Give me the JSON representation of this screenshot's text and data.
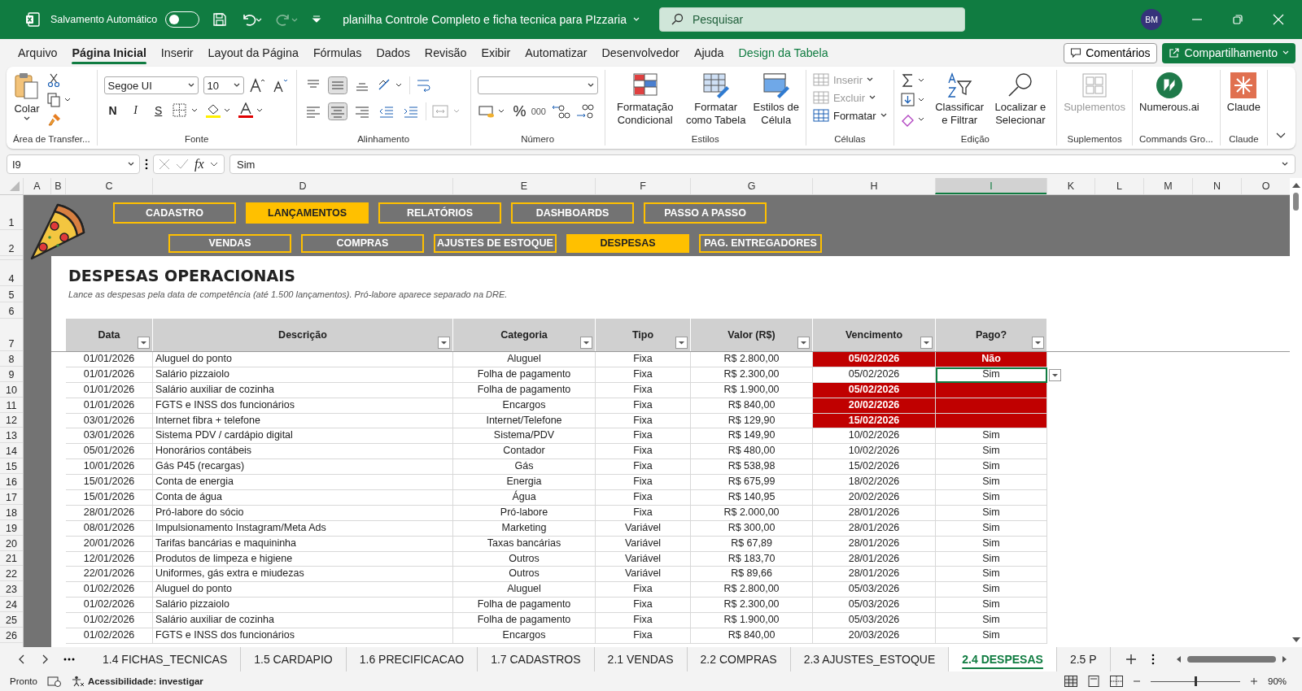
{
  "title_bar": {
    "autosave_label": "Salvamento Automático",
    "autosave_on": false,
    "document_title": "planilha Controle Completo e ficha tecnica para PIzzaria",
    "search_placeholder": "Pesquisar",
    "avatar": "BM"
  },
  "menu": [
    {
      "label": "Arquivo",
      "selected": false,
      "contextual": false
    },
    {
      "label": "Página Inicial",
      "selected": true,
      "contextual": false
    },
    {
      "label": "Inserir",
      "selected": false,
      "contextual": false
    },
    {
      "label": "Layout da Página",
      "selected": false,
      "contextual": false
    },
    {
      "label": "Fórmulas",
      "selected": false,
      "contextual": false
    },
    {
      "label": "Dados",
      "selected": false,
      "contextual": false
    },
    {
      "label": "Revisão",
      "selected": false,
      "contextual": false
    },
    {
      "label": "Exibir",
      "selected": false,
      "contextual": false
    },
    {
      "label": "Automatizar",
      "selected": false,
      "contextual": false
    },
    {
      "label": "Desenvolvedor",
      "selected": false,
      "contextual": false
    },
    {
      "label": "Ajuda",
      "selected": false,
      "contextual": false
    },
    {
      "label": "Design da Tabela",
      "selected": false,
      "contextual": true
    }
  ],
  "comments_button": "Comentários",
  "share_button": "Compartilhamento",
  "ribbon": [
    {
      "kind": "clipboard",
      "label": "Área de Transfer...",
      "paste": "Colar"
    },
    {
      "kind": "font",
      "label": "Fonte",
      "font": "Segoe UI",
      "size": "10",
      "bold": "N",
      "italic": "I",
      "underline": "S"
    },
    {
      "kind": "alignment",
      "label": "Alinhamento"
    },
    {
      "kind": "number",
      "label": "Número",
      "percent": "%",
      "thousands": "000"
    },
    {
      "kind": "large",
      "label": "Estilos",
      "buttons": [
        {
          "kind": "conditional",
          "label": "Formatação Condicional",
          "disabled": false
        },
        {
          "kind": "table",
          "label": "Formatar como Tabela",
          "disabled": false
        },
        {
          "kind": "styles",
          "label": "Estilos de Célula",
          "disabled": false
        }
      ]
    },
    {
      "kind": "cells",
      "label": "Células",
      "buttons": [
        {
          "label": "Inserir",
          "disabled": true
        },
        {
          "label": "Excluir",
          "disabled": true
        },
        {
          "label": "Formatar",
          "disabled": false
        }
      ]
    },
    {
      "kind": "editing",
      "label": "Edição",
      "buttons": [
        {
          "kind": "sort",
          "label": "Classificar e Filtrar",
          "disabled": false
        },
        {
          "kind": "find",
          "label": "Localizar e Selecionar",
          "disabled": false
        }
      ]
    },
    {
      "kind": "large",
      "label": "Suplementos",
      "buttons": [
        {
          "kind": "addins",
          "label": "Suplementos",
          "disabled": true
        }
      ]
    },
    {
      "kind": "large",
      "label": "Commands Gro...",
      "buttons": [
        {
          "kind": "numerous",
          "label": "Numerous.ai",
          "disabled": false
        }
      ]
    },
    {
      "kind": "large",
      "label": "Claude",
      "buttons": [
        {
          "kind": "claude",
          "label": "Claude",
          "disabled": false
        }
      ]
    }
  ],
  "formula_bar": {
    "name_box": "I9",
    "function_label": "fx",
    "formula": "Sim"
  },
  "column_headers": [
    {
      "label": "A",
      "selected": false
    },
    {
      "label": "B",
      "selected": false
    },
    {
      "label": "C",
      "selected": false
    },
    {
      "label": "D",
      "selected": false
    },
    {
      "label": "E",
      "selected": false
    },
    {
      "label": "F",
      "selected": false
    },
    {
      "label": "G",
      "selected": false
    },
    {
      "label": "H",
      "selected": false
    },
    {
      "label": "I",
      "selected": true
    },
    {
      "label": "K",
      "selected": false
    },
    {
      "label": "L",
      "selected": false
    },
    {
      "label": "M",
      "selected": false
    },
    {
      "label": "N",
      "selected": false
    },
    {
      "label": "O",
      "selected": false
    }
  ],
  "top_row_numbers": [
    "1",
    "2",
    "4",
    "5",
    "6",
    "7"
  ],
  "nav_primary": [
    {
      "label": "CADASTRO",
      "selected": false
    },
    {
      "label": "LANÇAMENTOS",
      "selected": true
    },
    {
      "label": "RELATÓRIOS",
      "selected": false
    },
    {
      "label": "DASHBOARDS",
      "selected": false
    },
    {
      "label": "PASSO A PASSO",
      "selected": false
    }
  ],
  "nav_secondary": [
    {
      "label": "VENDAS",
      "selected": false
    },
    {
      "label": "COMPRAS",
      "selected": false
    },
    {
      "label": "AJUSTES DE ESTOQUE",
      "selected": false
    },
    {
      "label": "DESPESAS",
      "selected": true
    },
    {
      "label": "PAG. ENTREGADORES",
      "selected": false
    }
  ],
  "heading": "DESPESAS OPERACIONAIS",
  "subtitle": "Lance as despesas pela data de competência (até 1.500 lançamentos). Pró-labore aparece separado na DRE.",
  "table": {
    "columns": [
      "Data",
      "Descrição",
      "Categoria",
      "Tipo",
      "Valor (R$)",
      "Vencimento",
      "Pago?"
    ],
    "rows": [
      {
        "row": "8",
        "date": "01/01/2026",
        "description": "Aluguel do ponto",
        "category": "Aluguel",
        "type": "Fixa",
        "value": "R$ 2.800,00",
        "due": "05/02/2026",
        "paid": "Não",
        "overdue": true,
        "selected": false
      },
      {
        "row": "9",
        "date": "01/01/2026",
        "description": "Salário pizzaiolo",
        "category": "Folha de pagamento",
        "type": "Fixa",
        "value": "R$ 2.300,00",
        "due": "05/02/2026",
        "paid": "Sim",
        "overdue": false,
        "selected": true
      },
      {
        "row": "10",
        "date": "01/01/2026",
        "description": "Salário auxiliar de cozinha",
        "category": "Folha de pagamento",
        "type": "Fixa",
        "value": "R$ 1.900,00",
        "due": "05/02/2026",
        "overdue": true,
        "selected": false
      },
      {
        "row": "11",
        "date": "01/01/2026",
        "description": "FGTS e INSS dos funcionários",
        "category": "Encargos",
        "type": "Fixa",
        "value": "R$ 840,00",
        "due": "20/02/2026",
        "overdue": true,
        "selected": false
      },
      {
        "row": "12",
        "date": "03/01/2026",
        "description": "Internet fibra + telefone",
        "category": "Internet/Telefone",
        "type": "Fixa",
        "value": "R$ 129,90",
        "due": "15/02/2026",
        "overdue": true,
        "selected": false
      },
      {
        "row": "13",
        "date": "03/01/2026",
        "description": "Sistema PDV / cardápio digital",
        "category": "Sistema/PDV",
        "type": "Fixa",
        "value": "R$ 149,90",
        "due": "10/02/2026",
        "paid": "Sim",
        "overdue": false,
        "selected": false
      },
      {
        "row": "14",
        "date": "05/01/2026",
        "description": "Honorários contábeis",
        "category": "Contador",
        "type": "Fixa",
        "value": "R$ 480,00",
        "due": "10/02/2026",
        "paid": "Sim",
        "overdue": false,
        "selected": false
      },
      {
        "row": "15",
        "date": "10/01/2026",
        "description": "Gás P45 (recargas)",
        "category": "Gás",
        "type": "Fixa",
        "value": "R$ 538,98",
        "due": "15/02/2026",
        "paid": "Sim",
        "overdue": false,
        "selected": false
      },
      {
        "row": "16",
        "date": "15/01/2026",
        "description": "Conta de energia",
        "category": "Energia",
        "type": "Fixa",
        "value": "R$ 675,99",
        "due": "18/02/2026",
        "paid": "Sim",
        "overdue": false,
        "selected": false
      },
      {
        "row": "17",
        "date": "15/01/2026",
        "description": "Conta de água",
        "category": "Água",
        "type": "Fixa",
        "value": "R$ 140,95",
        "due": "20/02/2026",
        "paid": "Sim",
        "overdue": false,
        "selected": false
      },
      {
        "row": "18",
        "date": "28/01/2026",
        "description": "Pró-labore do sócio",
        "category": "Pró-labore",
        "type": "Fixa",
        "value": "R$ 2.000,00",
        "due": "28/01/2026",
        "paid": "Sim",
        "overdue": false,
        "selected": false
      },
      {
        "row": "19",
        "date": "08/01/2026",
        "description": "Impulsionamento Instagram/Meta Ads",
        "category": "Marketing",
        "type": "Variável",
        "value": "R$ 300,00",
        "due": "28/01/2026",
        "paid": "Sim",
        "overdue": false,
        "selected": false
      },
      {
        "row": "20",
        "date": "20/01/2026",
        "description": "Tarifas bancárias e maquininha",
        "category": "Taxas bancárias",
        "type": "Variável",
        "value": "R$ 67,89",
        "due": "28/01/2026",
        "paid": "Sim",
        "overdue": false,
        "selected": false
      },
      {
        "row": "21",
        "date": "12/01/2026",
        "description": "Produtos de limpeza e higiene",
        "category": "Outros",
        "type": "Variável",
        "value": "R$ 183,70",
        "due": "28/01/2026",
        "paid": "Sim",
        "overdue": false,
        "selected": false
      },
      {
        "row": "22",
        "date": "22/01/2026",
        "description": "Uniformes, gás extra e miudezas",
        "category": "Outros",
        "type": "Variável",
        "value": "R$ 89,66",
        "due": "28/01/2026",
        "paid": "Sim",
        "overdue": false,
        "selected": false
      },
      {
        "row": "23",
        "date": "01/02/2026",
        "description": "Aluguel do ponto",
        "category": "Aluguel",
        "type": "Fixa",
        "value": "R$ 2.800,00",
        "due": "05/03/2026",
        "paid": "Sim",
        "overdue": false,
        "selected": false
      },
      {
        "row": "24",
        "date": "01/02/2026",
        "description": "Salário pizzaiolo",
        "category": "Folha de pagamento",
        "type": "Fixa",
        "value": "R$ 2.300,00",
        "due": "05/03/2026",
        "paid": "Sim",
        "overdue": false,
        "selected": false
      },
      {
        "row": "25",
        "date": "01/02/2026",
        "description": "Salário auxiliar de cozinha",
        "category": "Folha de pagamento",
        "type": "Fixa",
        "value": "R$ 1.900,00",
        "due": "05/03/2026",
        "paid": "Sim",
        "overdue": false,
        "selected": false
      },
      {
        "row": "26",
        "date": "01/02/2026",
        "description": "FGTS e INSS dos funcionários",
        "category": "Encargos",
        "type": "Fixa",
        "value": "R$ 840,00",
        "due": "20/03/2026",
        "paid": "Sim",
        "overdue": false,
        "selected": false
      }
    ]
  },
  "sheet_tabs": [
    {
      "label": "1.4 FICHAS_TECNICAS",
      "selected": false
    },
    {
      "label": "1.5 CARDAPIO",
      "selected": false
    },
    {
      "label": "1.6 PRECIFICACAO",
      "selected": false
    },
    {
      "label": "1.7 CADASTROS",
      "selected": false
    },
    {
      "label": "2.1 VENDAS",
      "selected": false
    },
    {
      "label": "2.2 COMPRAS",
      "selected": false
    },
    {
      "label": "2.3 AJUSTES_ESTOQUE",
      "selected": false
    },
    {
      "label": "2.4 DESPESAS",
      "selected": true
    },
    {
      "label": "2.5 P",
      "selected": false
    }
  ],
  "status_bar": {
    "status": "Pronto",
    "accessibility": "Acessibilidade: investigar",
    "zoom": "90%",
    "level": 0.5
  }
}
